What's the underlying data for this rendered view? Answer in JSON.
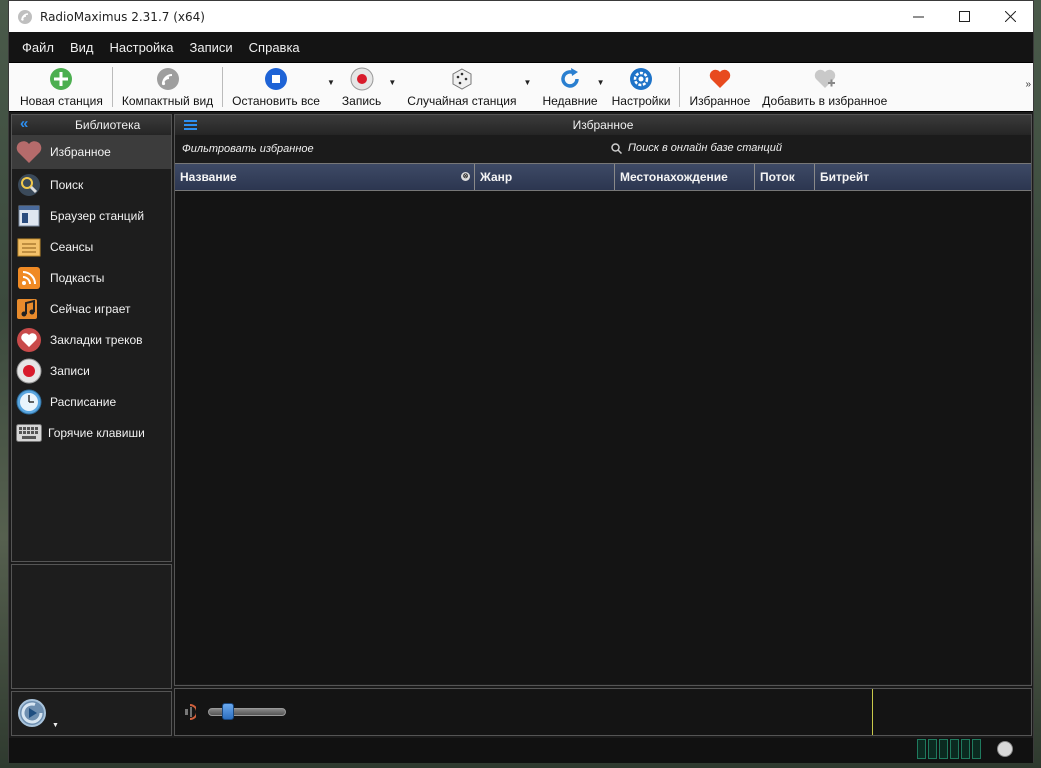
{
  "window": {
    "title": "RadioMaximus 2.31.7 (x64)",
    "controls": [
      "minimize",
      "maximize",
      "close"
    ]
  },
  "menu": {
    "items": [
      "Файл",
      "Вид",
      "Настройка",
      "Записи",
      "Справка"
    ]
  },
  "toolbar": {
    "buttons": [
      {
        "label": "Новая станция",
        "icon": "plus-circle-icon"
      },
      {
        "label": "Компактный вид",
        "icon": "radio-wave-icon"
      },
      {
        "label": "Остановить все",
        "icon": "stop-icon",
        "dropdown": true
      },
      {
        "label": "Запись",
        "icon": "record-icon",
        "dropdown": true
      },
      {
        "label": "Случайная станция",
        "icon": "dice-icon",
        "dropdown": true
      },
      {
        "label": "Недавние",
        "icon": "refresh-icon",
        "dropdown": true
      },
      {
        "label": "Настройки",
        "icon": "gear-icon"
      },
      {
        "label": "Избранное",
        "icon": "heart-icon"
      },
      {
        "label": "Добавить в избранное",
        "icon": "heart-add-icon"
      }
    ],
    "more": "»"
  },
  "sidebar": {
    "title": "Библиотека",
    "collapse": "«",
    "items": [
      {
        "label": "Избранное",
        "icon": "heart-icon",
        "active": true
      },
      {
        "label": "Поиск",
        "icon": "magnifier-icon"
      },
      {
        "label": "Браузер станций",
        "icon": "browser-icon"
      },
      {
        "label": "Сеансы",
        "icon": "sessions-icon"
      },
      {
        "label": "Подкасты",
        "icon": "rss-icon"
      },
      {
        "label": "Сейчас играет",
        "icon": "music-note-icon"
      },
      {
        "label": "Закладки треков",
        "icon": "bookmark-heart-icon"
      },
      {
        "label": "Записи",
        "icon": "record-icon"
      },
      {
        "label": "Расписание",
        "icon": "clock-icon"
      },
      {
        "label": "Горячие клавиши",
        "icon": "keyboard-icon"
      }
    ]
  },
  "content": {
    "title": "Избранное",
    "filter_placeholder": "Фильтровать избранное",
    "search_online": "Поиск в онлайн базе станций",
    "columns": [
      "Название",
      "Жанр",
      "Местонахождение",
      "Поток",
      "Битрейт"
    ]
  },
  "colors": {
    "accent": "#2d8ff0",
    "toolbar_bg": "#fafafa",
    "panel_bg": "#1b1b1b",
    "table_header": "#34405c"
  }
}
